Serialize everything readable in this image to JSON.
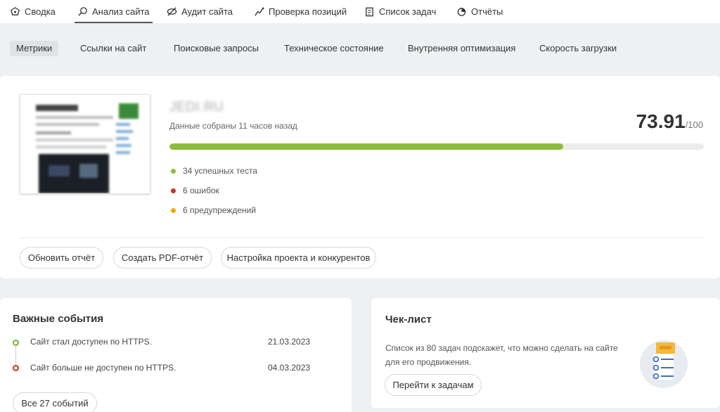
{
  "topnav": [
    {
      "label": "Сводка",
      "icon": "gauge-icon"
    },
    {
      "label": "Анализ сайта",
      "icon": "magnifier-icon"
    },
    {
      "label": "Аудит сайта",
      "icon": "audit-icon"
    },
    {
      "label": "Проверка позиций",
      "icon": "line-chart-icon"
    },
    {
      "label": "Список задач",
      "icon": "clipboard-icon"
    },
    {
      "label": "Отчёты",
      "icon": "pie-chart-icon"
    }
  ],
  "subnav": [
    "Метрики",
    "Ссылки на сайт",
    "Поисковые запросы",
    "Техническое состояние",
    "Внутренняя оптимизация",
    "Скорость загрузки"
  ],
  "site": {
    "domain": "JEDI.RU",
    "collected": "Данные собраны 11 часов назад",
    "score": "73.91",
    "score_max": "/100",
    "progress": 0.737
  },
  "stats": [
    {
      "label": "34 успешных теста",
      "color": "#8dbc3c"
    },
    {
      "label": "6 ошибок",
      "color": "#c0392b"
    },
    {
      "label": "6 предупреждений",
      "color": "#f0a800"
    }
  ],
  "buttons": {
    "refresh": "Обновить отчёт",
    "pdf": "Создать PDF-отчёт",
    "settings": "Настройка проекта и конкурентов"
  },
  "events": {
    "title": "Важные события",
    "items": [
      {
        "text": "Сайт стал доступен по HTTPS.",
        "date": "21.03.2023",
        "color": "#7ab233"
      },
      {
        "text": "Сайт больше не доступен по HTTPS.",
        "date": "04.03.2023",
        "color": "#c0392b"
      }
    ],
    "all_button": "Все 27 событий"
  },
  "checklist": {
    "title": "Чек-лист",
    "text": "Список из 80 задач подскажет, что можно сделать на сайте для его продвижения.",
    "button": "Перейти к задачам"
  }
}
